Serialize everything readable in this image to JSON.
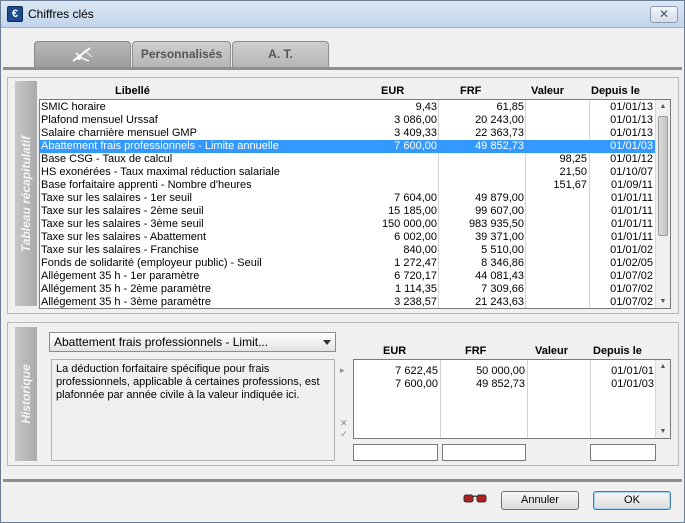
{
  "window": {
    "title": "Chiffres clés",
    "close_label": "✕",
    "app_icon_glyph": "€"
  },
  "tabs": [
    {
      "label": "",
      "icon": "fishing-icon",
      "active": true
    },
    {
      "label": "Personnalisés",
      "active": false
    },
    {
      "label": "A. T.",
      "active": false
    }
  ],
  "summary": {
    "side_label": "Tableau récapitulatif",
    "columns": {
      "libelle": "Libellé",
      "eur": "EUR",
      "frf": "FRF",
      "valeur": "Valeur",
      "depuis": "Depuis le"
    },
    "rows": [
      {
        "libelle": "SMIC horaire",
        "eur": "9,43",
        "frf": "61,85",
        "valeur": "",
        "depuis": "01/01/13"
      },
      {
        "libelle": "Plafond mensuel Urssaf",
        "eur": "3 086,00",
        "frf": "20 243,00",
        "valeur": "",
        "depuis": "01/01/13"
      },
      {
        "libelle": "Salaire charnière mensuel GMP",
        "eur": "3 409,33",
        "frf": "22 363,73",
        "valeur": "",
        "depuis": "01/01/13"
      },
      {
        "libelle": "Abattement frais professionnels - Limite annuelle",
        "eur": "7 600,00",
        "frf": "49 852,73",
        "valeur": "",
        "depuis": "01/01/03",
        "selected": true
      },
      {
        "libelle": "Base CSG - Taux de calcul",
        "eur": "",
        "frf": "",
        "valeur": "98,25",
        "depuis": "01/01/12"
      },
      {
        "libelle": "HS exonérées - Taux maximal réduction salariale",
        "eur": "",
        "frf": "",
        "valeur": "21,50",
        "depuis": "01/10/07"
      },
      {
        "libelle": "Base forfaitaire apprenti - Nombre d'heures",
        "eur": "",
        "frf": "",
        "valeur": "151,67",
        "depuis": "01/09/11"
      },
      {
        "libelle": "Taxe sur les salaires - 1er seuil",
        "eur": "7 604,00",
        "frf": "49 879,00",
        "valeur": "",
        "depuis": "01/01/11"
      },
      {
        "libelle": "Taxe sur les salaires - 2ème seuil",
        "eur": "15 185,00",
        "frf": "99 607,00",
        "valeur": "",
        "depuis": "01/01/11"
      },
      {
        "libelle": "Taxe sur les salaires - 3ème seuil",
        "eur": "150 000,00",
        "frf": "983 935,50",
        "valeur": "",
        "depuis": "01/01/11"
      },
      {
        "libelle": "Taxe sur les salaires - Abattement",
        "eur": "6 002,00",
        "frf": "39 371,00",
        "valeur": "",
        "depuis": "01/01/11"
      },
      {
        "libelle": "Taxe sur les salaires - Franchise",
        "eur": "840,00",
        "frf": "5 510,00",
        "valeur": "",
        "depuis": "01/01/02"
      },
      {
        "libelle": "Fonds de solidarité (employeur public) - Seuil",
        "eur": "1 272,47",
        "frf": "8 346,86",
        "valeur": "",
        "depuis": "01/02/05"
      },
      {
        "libelle": "Allégement 35 h - 1er paramètre",
        "eur": "6 720,17",
        "frf": "44 081,43",
        "valeur": "",
        "depuis": "01/07/02"
      },
      {
        "libelle": "Allégement 35 h - 2ème paramètre",
        "eur": "1 114,35",
        "frf": "7 309,66",
        "valeur": "",
        "depuis": "01/07/02"
      },
      {
        "libelle": "Allégement 35 h - 3ème paramètre",
        "eur": "3 238,57",
        "frf": "21 243,63",
        "valeur": "",
        "depuis": "01/07/02"
      }
    ]
  },
  "history": {
    "side_label": "Historique",
    "selected_item": "Abattement frais professionnels - Limit...",
    "description": "La déduction forfaitaire spécifique pour frais professionnels, applicable à certaines professions, est plafonnée par année civile à la valeur indiquée ici.",
    "columns": {
      "eur": "EUR",
      "frf": "FRF",
      "valeur": "Valeur",
      "depuis": "Depuis le"
    },
    "rows": [
      {
        "eur": "7 622,45",
        "frf": "50 000,00",
        "valeur": "",
        "depuis": "01/01/01"
      },
      {
        "eur": "7 600,00",
        "frf": "49 852,73",
        "valeur": "",
        "depuis": "01/01/03"
      }
    ]
  },
  "footer": {
    "cancel_label": "Annuler",
    "ok_label": "OK"
  },
  "colors": {
    "selection": "#3399ff",
    "tab_active": "#9c9c9c",
    "side_label": "#aaaaaa"
  }
}
